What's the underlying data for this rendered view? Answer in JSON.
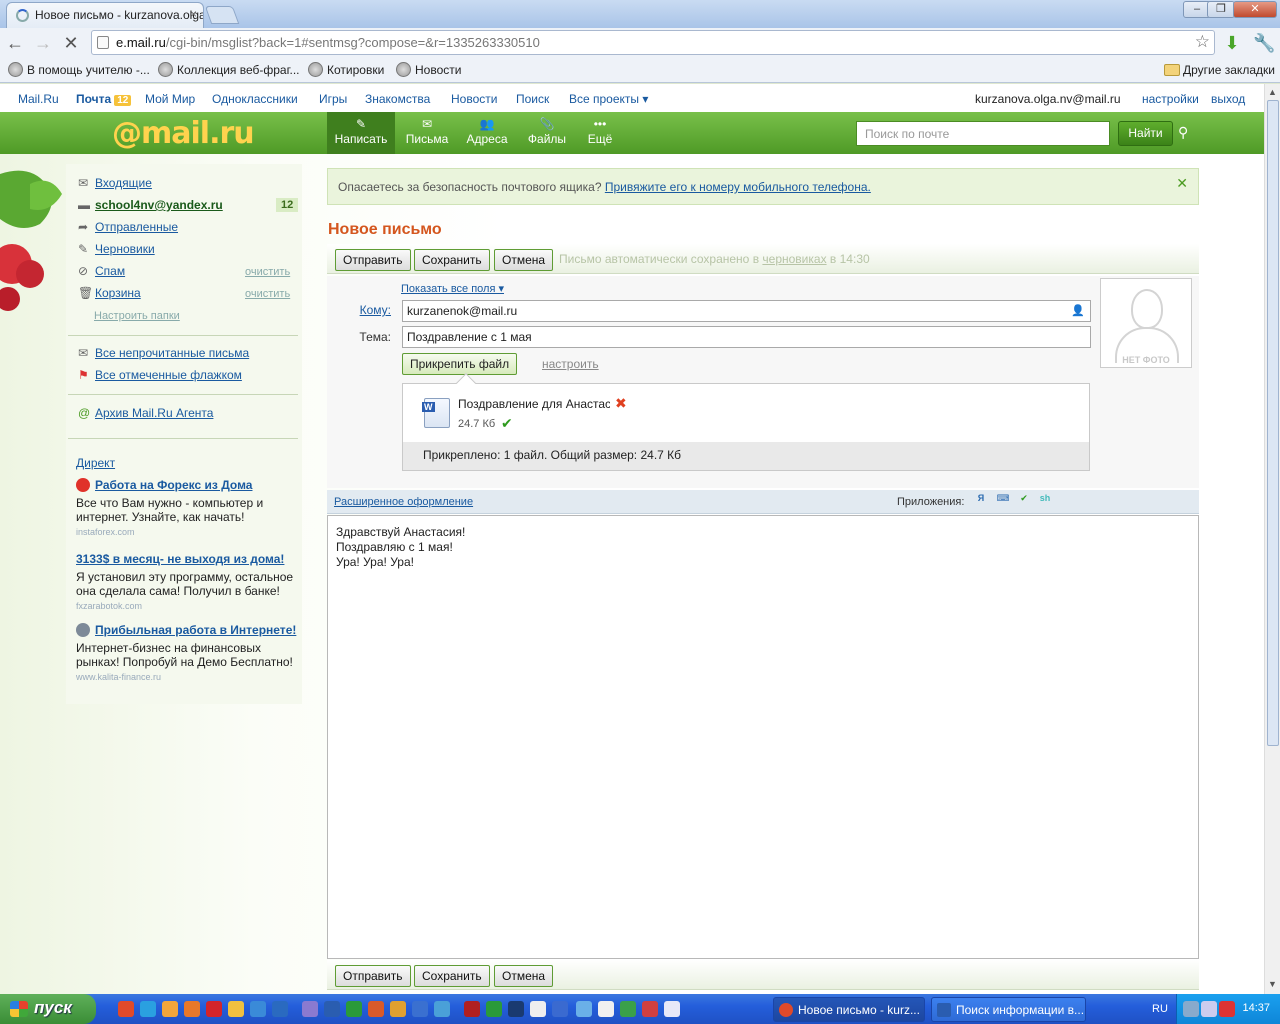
{
  "browser": {
    "tab_title": "Новое письмо - kurzanova.olga",
    "tab_close": "×",
    "window_buttons": [
      "‒",
      "❐",
      "✕"
    ],
    "url_host": "e.mail.ru",
    "url_rest": "/cgi-bin/msglist?back=1#sentmsg?compose=&r=1335263330510",
    "bookmarks": [
      "В помощь учителю -...",
      "Коллекция веб-фраг...",
      "Котировки",
      "Новости"
    ],
    "other_bookmarks": "Другие закладки"
  },
  "portal": {
    "links": [
      "Mail.Ru",
      "Почта",
      "Мой Мир",
      "Одноклассники",
      "Игры",
      "Знакомства",
      "Новости",
      "Поиск",
      "Все проекты ▾"
    ],
    "mail_count": "12",
    "user_email": "kurzanova.olga.nv@mail.ru",
    "settings": "настройки",
    "logout": "выход"
  },
  "header": {
    "logo": "@mail.ru",
    "tools": [
      {
        "label": "Написать",
        "icon": "✎"
      },
      {
        "label": "Письма",
        "icon": "✉"
      },
      {
        "label": "Адреса",
        "icon": "👥"
      },
      {
        "label": "Файлы",
        "icon": "📎"
      },
      {
        "label": "Ещё",
        "icon": "•••"
      }
    ],
    "search_placeholder": "Поиск по почте",
    "search_button": "Найти"
  },
  "sidebar": {
    "folders": [
      {
        "label": "Входящие",
        "icon": "✉"
      },
      {
        "label": "school4nv@yandex.ru",
        "icon": "▬",
        "count": "12"
      },
      {
        "label": "Отправленные",
        "icon": "➦"
      },
      {
        "label": "Черновики",
        "icon": "✎"
      },
      {
        "label": "Спам",
        "icon": "⊘",
        "action": "очистить"
      },
      {
        "label": "Корзина",
        "icon": "🗑",
        "action": "очистить"
      }
    ],
    "setup_folders": "Настроить папки",
    "filters": [
      {
        "label": "Все непрочитанные письма",
        "icon": "✉"
      },
      {
        "label": "Все отмеченные флажком",
        "icon": "⚑"
      }
    ],
    "archive": "Архив Mail.Ru Агента",
    "direct": "Директ",
    "ads": [
      {
        "title": "Работа на Форекс из Дома",
        "body": "Все что Вам нужно - компьютер и интернет. Узнайте, как начать!",
        "url": "instaforex.com"
      },
      {
        "title": "3133$ в месяц- не выходя из дома!",
        "body": "Я установил эту программу, остальное она сделала сама! Получил в банке!",
        "url": "fxzarabotok.com"
      },
      {
        "title": "Прибыльная работа в Интернете!",
        "body": "Интернет-бизнес на финансовых рынках! Попробуй на Демо Бесплатно!",
        "url": "www.kalita-finance.ru"
      }
    ]
  },
  "notice": {
    "text": "Опасаетесь за безопасность почтового ящика?",
    "link": "Привяжите его к номеру мобильного телефона."
  },
  "compose": {
    "title": "Новое письмо",
    "buttons": {
      "send": "Отправить",
      "save": "Сохранить",
      "cancel": "Отмена"
    },
    "autosave_pre": "Письмо автоматически сохранено в",
    "autosave_link": "черновиках",
    "autosave_post": "в 14:30",
    "show_all_fields": "Показать все поля ▾",
    "to_label": "Кому:",
    "to_value": "kurzanenok@mail.ru",
    "subject_label": "Тема:",
    "subject_value": "Поздравление с 1 мая",
    "attach_button": "Прикрепить файл",
    "attach_setup": "настроить",
    "no_photo": "НЕТ ФОТО",
    "attachment": {
      "name": "Поздравление для Анастасии",
      "size": "24.7 Кб"
    },
    "attach_summary": "Прикреплено: 1 файл. Общий размер: 24.7 Кб",
    "rich_format": "Расширенное оформление",
    "apps_label": "Приложения:",
    "body_lines": [
      "Здравствуй Анастасия!",
      "Поздравляю с 1 мая!",
      "Ура! Ура! Ура!"
    ]
  },
  "taskbar": {
    "start": "пуск",
    "tasks": [
      "Новое письмо - kurz...",
      "Поиск информации в..."
    ],
    "lang": "RU",
    "time": "14:37"
  }
}
